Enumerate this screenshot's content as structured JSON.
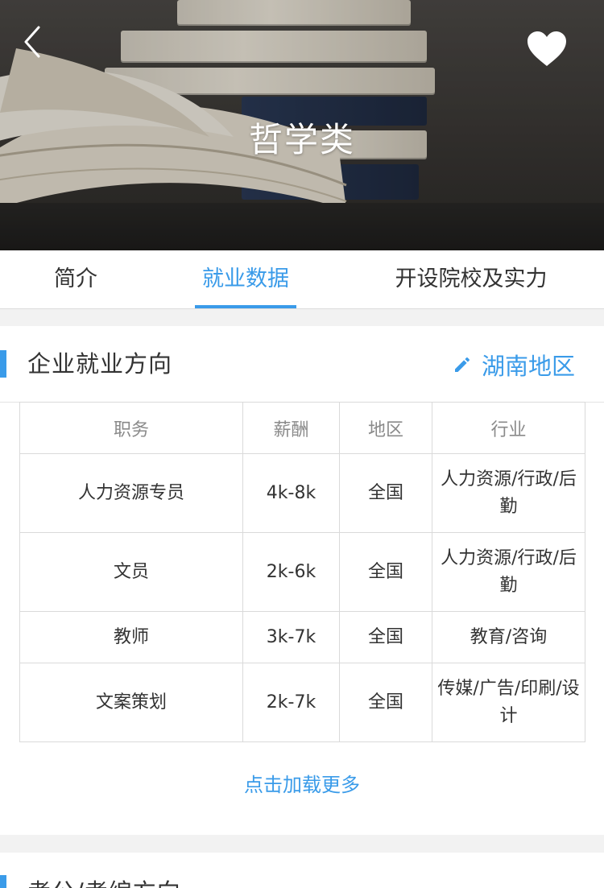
{
  "header": {
    "title": "哲学类",
    "back_icon": "chevron-left-icon",
    "favorite_icon": "heart-icon"
  },
  "tabs": [
    {
      "label": "简介",
      "active": false
    },
    {
      "label": "就业数据",
      "active": true
    },
    {
      "label": "开设院校及实力",
      "active": false
    }
  ],
  "employment": {
    "title": "企业就业方向",
    "region_label": "湖南地区",
    "region_icon": "pencil-icon",
    "columns": [
      "职务",
      "薪酬",
      "地区",
      "行业"
    ],
    "rows": [
      {
        "position": "人力资源专员",
        "salary": "4k-8k",
        "region": "全国",
        "industry": "人力资源/行政/后勤"
      },
      {
        "position": "文员",
        "salary": "2k-6k",
        "region": "全国",
        "industry": "人力资源/行政/后勤"
      },
      {
        "position": "教师",
        "salary": "3k-7k",
        "region": "全国",
        "industry": "教育/咨询"
      },
      {
        "position": "文案策划",
        "salary": "2k-7k",
        "region": "全国",
        "industry": "传媒/广告/印刷/设计"
      }
    ],
    "load_more": "点击加载更多"
  },
  "next_section": {
    "title": "考公/考编方向"
  },
  "colors": {
    "accent": "#3a9be9",
    "text": "#333333",
    "muted": "#8a8a8a"
  }
}
